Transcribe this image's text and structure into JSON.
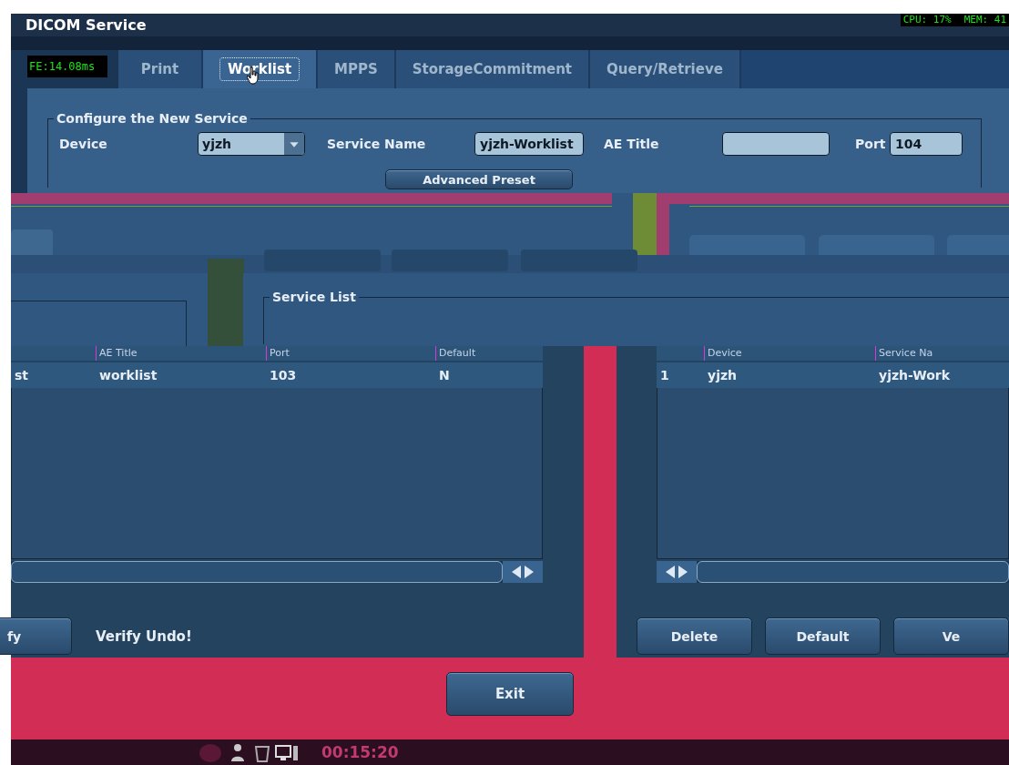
{
  "status_overlay": {
    "cpu": "CPU: 17%",
    "mem": "MEM: 41"
  },
  "window": {
    "title": "DICOM Service"
  },
  "frame_time": "FE:14.08ms",
  "tabs": [
    {
      "label": "Print",
      "selected": false
    },
    {
      "label": "Worklist",
      "selected": true
    },
    {
      "label": "MPPS",
      "selected": false
    },
    {
      "label": "StorageCommitment",
      "selected": false
    },
    {
      "label": "Query/Retrieve",
      "selected": false
    }
  ],
  "configure": {
    "legend": "Configure the New Service",
    "device_label": "Device",
    "device_value": "yjzh",
    "service_name_label": "Service Name",
    "service_name_value": "yjzh-Worklist",
    "ae_title_label": "AE Title",
    "port_label": "Port",
    "port_value": "104",
    "advanced_button": "Advanced Preset"
  },
  "service_list": {
    "legend": "Service List"
  },
  "left_table": {
    "columns": [
      "",
      "AE Title",
      "Port",
      "Default"
    ],
    "rows": [
      [
        "st",
        "worklist",
        "103",
        "N"
      ]
    ]
  },
  "right_table": {
    "columns": [
      "",
      "Device",
      "Service Na"
    ],
    "rows": [
      [
        "1",
        "yjzh",
        "yjzh-Work"
      ]
    ]
  },
  "left_buttons": [
    "fy"
  ],
  "verify_message": "Verify Undo!",
  "right_buttons": [
    "Delete",
    "Default",
    "Ve"
  ],
  "exit_button": "Exit",
  "taskbar": {
    "time": "00:15:20"
  }
}
